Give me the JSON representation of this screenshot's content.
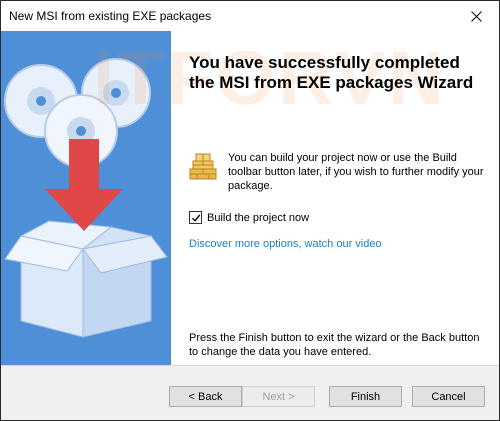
{
  "window": {
    "title": "New MSI from existing EXE packages"
  },
  "watermark": "ITFORVN",
  "heading": "You have successfully completed the MSI from EXE packages Wizard",
  "info_text": "You can build your project now or use the Build toolbar button later, if you wish to further modify your package.",
  "build_checkbox": {
    "label": "Build the project now",
    "checked": true
  },
  "link_text": "Discover more options, watch our video",
  "footer_text": "Press the Finish button to exit the wizard or the Back button to change the data you have entered.",
  "buttons": {
    "back": "< Back",
    "next": "Next >",
    "finish": "Finish",
    "cancel": "Cancel"
  },
  "colors": {
    "panel_blue": "#4f8fd8",
    "link": "#1a7fc4",
    "arrow_red": "#e04848"
  }
}
